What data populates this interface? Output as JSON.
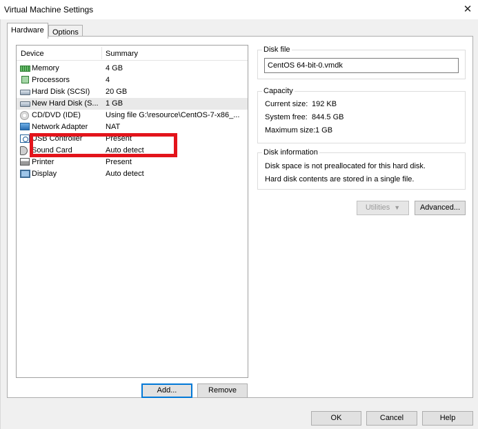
{
  "window": {
    "title": "Virtual Machine Settings",
    "close_glyph": "✕"
  },
  "tabs": [
    {
      "label": "Hardware"
    },
    {
      "label": "Options"
    }
  ],
  "device_list": {
    "columns": {
      "device": "Device",
      "summary": "Summary"
    },
    "rows": [
      {
        "device": "Memory",
        "summary": "4 GB",
        "icon": "memory-icon"
      },
      {
        "device": "Processors",
        "summary": "4",
        "icon": "processor-icon"
      },
      {
        "device": "Hard Disk (SCSI)",
        "summary": "20 GB",
        "icon": "hard-disk-icon"
      },
      {
        "device": "New Hard Disk (S...",
        "summary": "1 GB",
        "icon": "hard-disk-icon"
      },
      {
        "device": "CD/DVD (IDE)",
        "summary": "Using file G:\\resource\\CentOS-7-x86_...",
        "icon": "cd-dvd-icon"
      },
      {
        "device": "Network Adapter",
        "summary": "NAT",
        "icon": "network-adapter-icon"
      },
      {
        "device": "USB Controller",
        "summary": "Present",
        "icon": "usb-icon"
      },
      {
        "device": "Sound Card",
        "summary": "Auto detect",
        "icon": "sound-card-icon"
      },
      {
        "device": "Printer",
        "summary": "Present",
        "icon": "printer-icon"
      },
      {
        "device": "Display",
        "summary": "Auto detect",
        "icon": "display-icon"
      }
    ]
  },
  "list_buttons": {
    "add": "Add...",
    "remove": "Remove"
  },
  "disk_file": {
    "title": "Disk file",
    "value": "CentOS 64-bit-0.vmdk"
  },
  "capacity": {
    "title": "Capacity",
    "current_size_label": "Current size:",
    "current_size": "192 KB",
    "system_free_label": "System free:",
    "system_free": "844.5 GB",
    "maximum_size_label": "Maximum size:",
    "maximum_size": "1 GB"
  },
  "disk_information": {
    "title": "Disk information",
    "line1": "Disk space is not preallocated for this hard disk.",
    "line2": "Hard disk contents are stored in a single file."
  },
  "disk_buttons": {
    "utilities": "Utilities",
    "advanced": "Advanced..."
  },
  "dialog_buttons": {
    "ok": "OK",
    "cancel": "Cancel",
    "help": "Help"
  },
  "colors": {
    "highlight_box": "#e3141b",
    "selected_row": "#e9e9e9",
    "default_button_border": "#0078d7"
  }
}
